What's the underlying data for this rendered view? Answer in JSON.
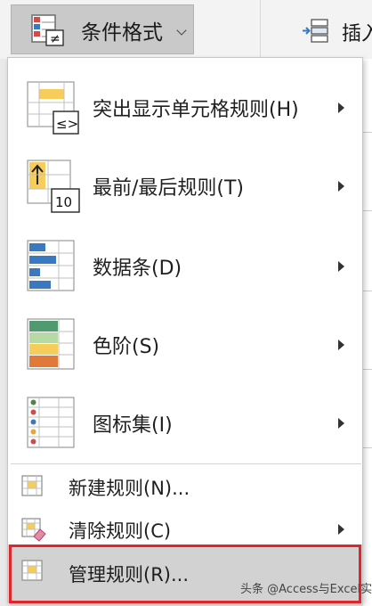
{
  "ribbon": {
    "conditional_format_label": "条件格式",
    "insert_label": "插入"
  },
  "menu": {
    "big_items": [
      {
        "label": "突出显示单元格规则(H)",
        "icon": "highlight-cells-rules-icon",
        "has_submenu": true
      },
      {
        "label": "最前/最后规则(T)",
        "icon": "top-bottom-rules-icon",
        "has_submenu": true
      },
      {
        "label": "数据条(D)",
        "icon": "data-bars-icon",
        "has_submenu": true
      },
      {
        "label": "色阶(S)",
        "icon": "color-scales-icon",
        "has_submenu": true
      },
      {
        "label": "图标集(I)",
        "icon": "icon-sets-icon",
        "has_submenu": true
      }
    ],
    "small_items": [
      {
        "label": "新建规则(N)...",
        "icon": "new-rule-icon",
        "has_submenu": false
      },
      {
        "label": "清除规则(C)",
        "icon": "clear-rules-icon",
        "has_submenu": true
      },
      {
        "label": "管理规则(R)...",
        "icon": "manage-rules-icon",
        "has_submenu": false,
        "highlighted": true
      }
    ],
    "top_bottom_icon_number": "10",
    "highlight_icon_symbol": "≤>"
  },
  "colors": {
    "highlight_outline": "#e0262c",
    "active_item_bg": "#d2d2d2",
    "yellow_fill": "#f6cc5a",
    "data_bar_blue": "#3a78c2"
  },
  "watermark": "头条 @Access与Excel实战"
}
